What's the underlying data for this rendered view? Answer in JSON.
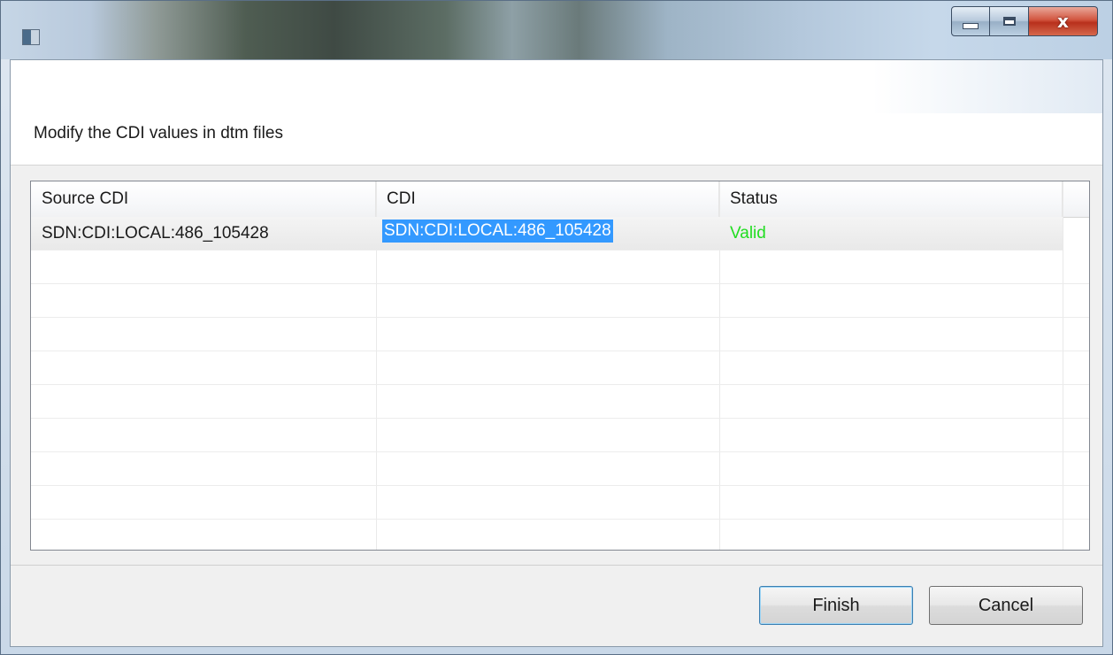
{
  "window": {
    "title": "",
    "controls": {
      "minimize_icon": "minimize-icon",
      "maximize_icon": "maximize-icon",
      "close_glyph": "x"
    }
  },
  "header": {
    "text": "Modify the CDI values in dtm files"
  },
  "table": {
    "columns": [
      "Source CDI",
      "CDI",
      "Status"
    ],
    "rows": [
      {
        "source_cdi": "SDN:CDI:LOCAL:486_105428",
        "cdi": "SDN:CDI:LOCAL:486_105428",
        "status": "Valid"
      }
    ]
  },
  "colors": {
    "status_valid": "#22dd22",
    "selection": "#3399ff"
  },
  "buttons": {
    "finish": "Finish",
    "cancel": "Cancel"
  }
}
